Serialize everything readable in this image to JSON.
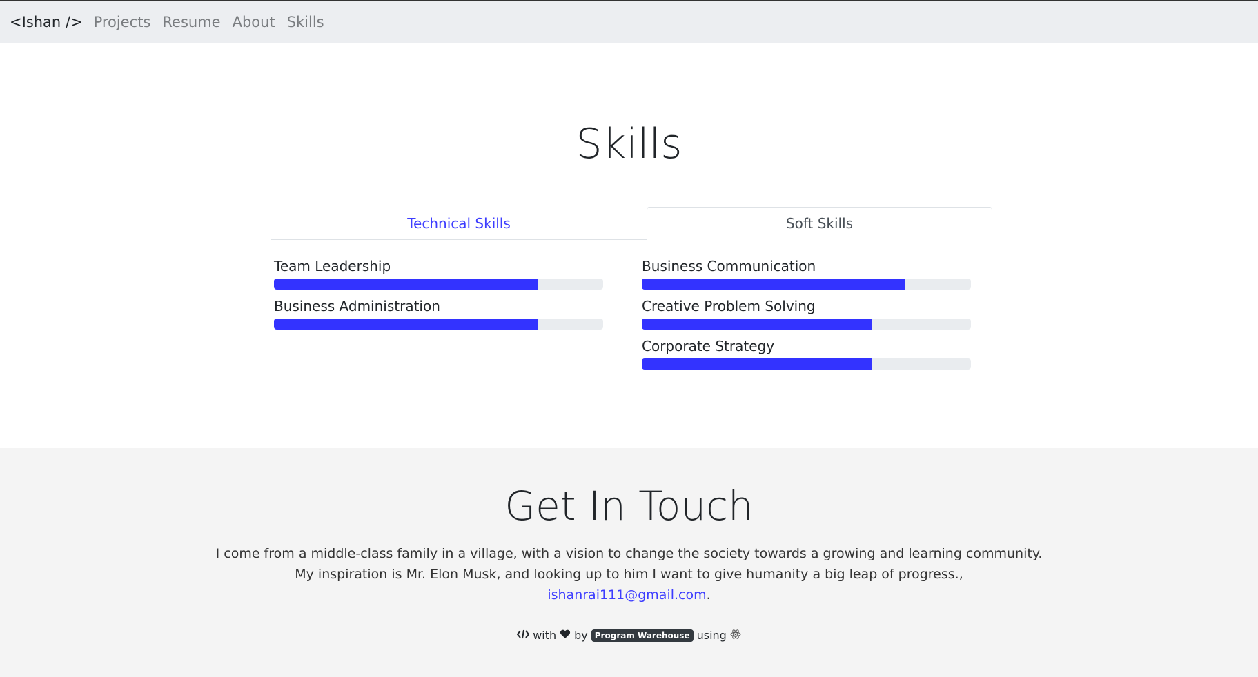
{
  "navbar": {
    "brand": "<Ishan />",
    "links": [
      "Projects",
      "Resume",
      "About",
      "Skills"
    ]
  },
  "skills": {
    "title": "Skills",
    "tabs": {
      "technical": "Technical Skills",
      "soft": "Soft Skills"
    },
    "left_items": [
      {
        "label": "Team Leadership",
        "level": 0.8
      },
      {
        "label": "Business Administration",
        "level": 0.8
      }
    ],
    "right_items": [
      {
        "label": "Business Communication",
        "level": 0.8
      },
      {
        "label": "Creative Problem Solving",
        "level": 0.7
      },
      {
        "label": "Corporate Strategy",
        "level": 0.7
      }
    ],
    "bar_color": "#3333ff"
  },
  "contact": {
    "title": "Get In Touch",
    "line1": "I come from a middle-class family in a village, with a vision to change the society towards a growing and learning community.",
    "line2": "My inspiration is Mr. Elon Musk, and looking up to him I want to give humanity a big leap of progress.,",
    "email": "ishanrai111@gmail.com",
    "email_suffix": "."
  },
  "footer": {
    "with": "with",
    "by": "by",
    "badge": "Program Warehouse",
    "using": "using",
    "icons": [
      "code-icon",
      "heart-icon",
      "react-icon"
    ]
  }
}
